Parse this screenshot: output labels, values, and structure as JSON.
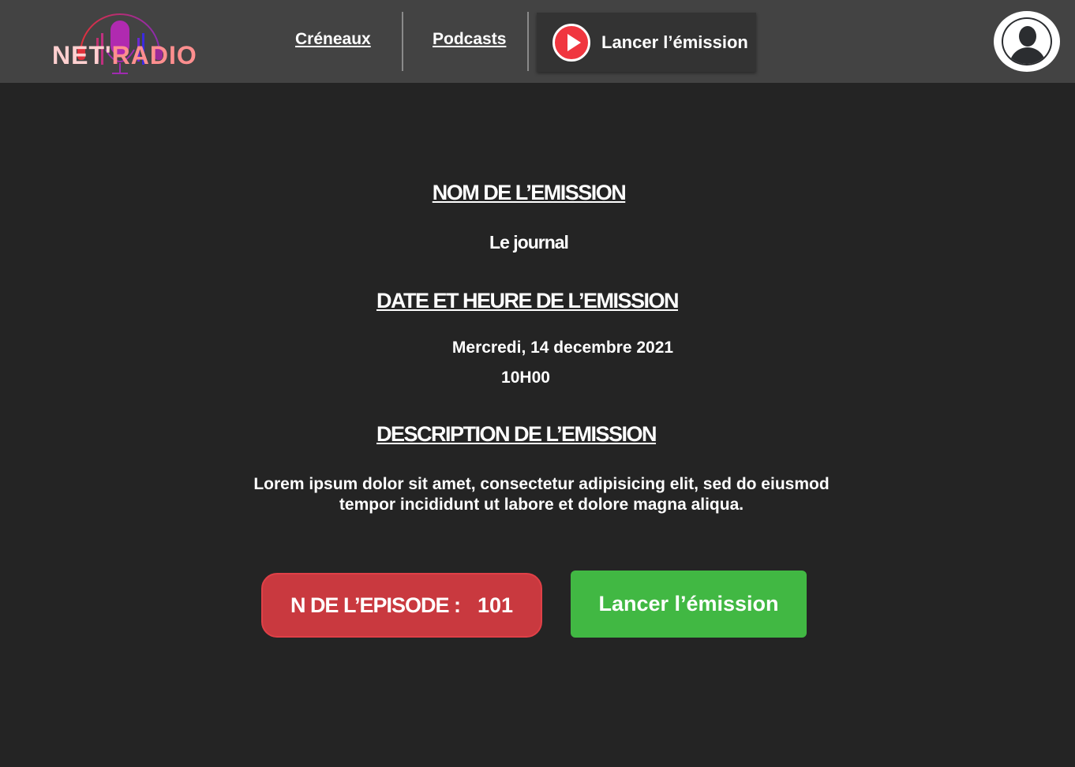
{
  "header": {
    "logo": {
      "part1": "NET'",
      "part2": "RADIO"
    },
    "nav": [
      {
        "label": "Créneaux"
      },
      {
        "label": "Podcasts"
      }
    ],
    "play_button": {
      "label": "Lancer l’émission"
    }
  },
  "main": {
    "name_heading": "NOM DE L’EMISSION",
    "name_value": "Le journal",
    "date_heading": "DATE ET HEURE DE L’EMISSION",
    "date_value": "Mercredi, 14 decembre 2021",
    "time_value": "10H00",
    "description_heading": "DESCRIPTION DE L’EMISSION",
    "description_line1": "Lorem ipsum dolor sit amet, consectetur adipisicing elit, sed do eiusmod",
    "description_line2": "tempor incididunt ut labore et dolore magna aliqua.",
    "episode_label": "N DE L’EPISODE :",
    "episode_number": "101",
    "launch_button": "Lancer l’émission"
  },
  "colors": {
    "header": "#434343",
    "background": "#242424",
    "episode": "#c9393f",
    "launch": "#41b843",
    "play": "#f0363f"
  }
}
